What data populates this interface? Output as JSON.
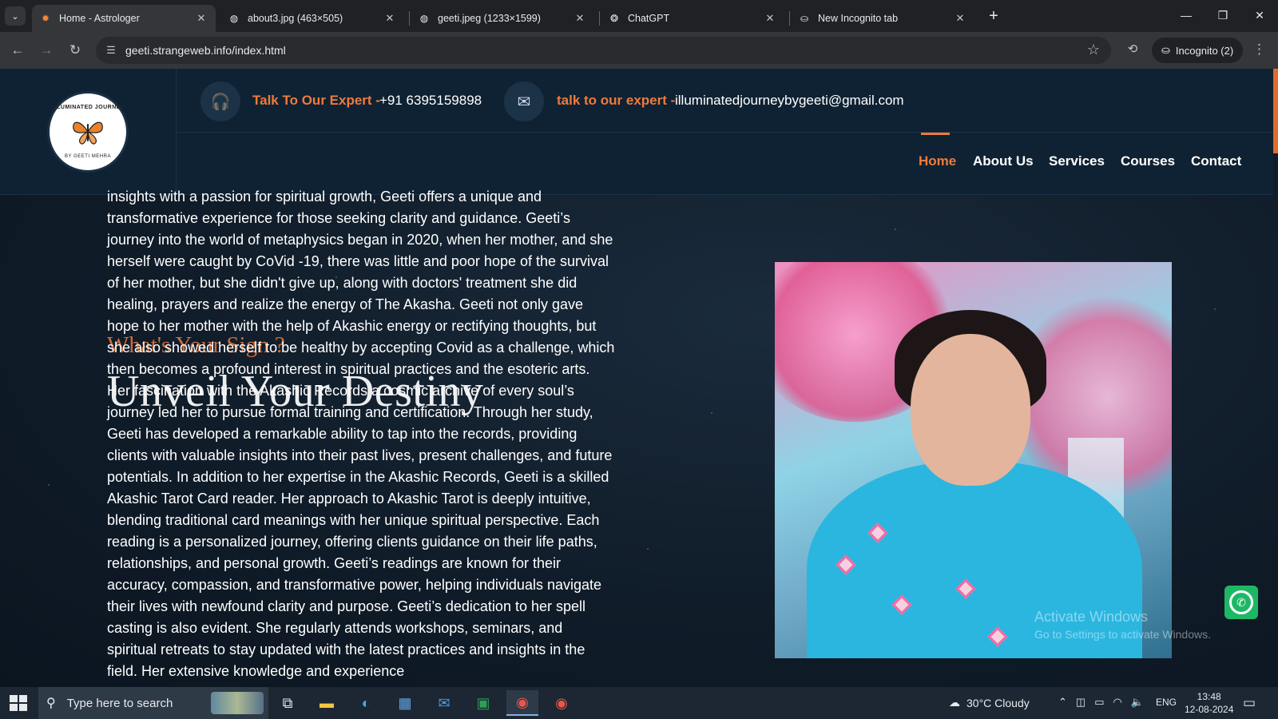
{
  "browser": {
    "tabs": [
      {
        "title": "Home - Astrologer",
        "icon": "sun-icon",
        "active": true
      },
      {
        "title": "about3.jpg (463×505)",
        "icon": "globe-icon",
        "active": false
      },
      {
        "title": "geeti.jpeg (1233×1599)",
        "icon": "globe-icon",
        "active": false
      },
      {
        "title": "ChatGPT",
        "icon": "chatgpt-icon",
        "active": false
      },
      {
        "title": "New Incognito tab",
        "icon": "incognito-icon",
        "active": false
      }
    ],
    "url": "geeti.strangeweb.info/index.html",
    "incognito_label": "Incognito (2)"
  },
  "site": {
    "logo": {
      "top_text": "ILLUMINATED JOURNEY",
      "bottom_text": "BY GEETI MEHRA"
    },
    "contact": {
      "phone_label": "Talk To Our Expert -",
      "phone_value": "+91 6395159898",
      "email_label": "talk to our expert -",
      "email_value": "illuminatedjourneybygeeti@gmail.com"
    },
    "nav": [
      {
        "label": "Home",
        "active": true
      },
      {
        "label": "About Us",
        "active": false
      },
      {
        "label": "Services",
        "active": false
      },
      {
        "label": "Courses",
        "active": false
      },
      {
        "label": "Contact",
        "active": false
      }
    ],
    "about_text": "insights with a passion for spiritual growth, Geeti offers a unique and transformative experience for those seeking clarity and guidance. Geeti’s journey into the world of metaphysics began in 2020, when her mother, and she herself were caught by CoVid -19, there was little and poor hope of the survival of her mother, but she didn't give up, along with doctors' treatment she did healing, prayers and realize the energy of The Akasha. Geeti not only gave hope to her mother with the help of Akashic energy or rectifying thoughts, but she also showed herself to be healthy by accepting Covid as a challenge, which then becomes a profound interest in spiritual practices and the esoteric arts. Her fascination with the Akashic Records a cosmic archive of every soul’s journey led her to pursue formal training and certification. Through her study, Geeti has developed a remarkable ability to tap into the records, providing clients with valuable insights into their past lives, present challenges, and future potentials. In addition to her expertise in the Akashic Records, Geeti is a skilled Akashic Tarot Card reader. Her approach to Akashic Tarot is deeply intuitive, blending traditional card meanings with her unique spiritual perspective. Each reading is a personalized journey, offering clients guidance on their life paths, relationships, and personal growth. Geeti’s readings are known for their accuracy, compassion, and transformative power, helping individuals navigate their lives with newfound clarity and purpose. Geeti’s dedication to her spell casting is also evident. She regularly attends workshops, seminars, and spiritual retreats to stay updated with the latest practices and insights in the field. Her extensive knowledge and experience",
    "sign_heading": "What's Your Sign ?",
    "destiny_heading": "Unveil Your Destiny",
    "watermark_title": "Activate Windows",
    "watermark_sub": "Go to Settings to activate Windows."
  },
  "taskbar": {
    "search_placeholder": "Type here to search",
    "weather": "30°C  Cloudy",
    "lang": "ENG",
    "time": "13:48",
    "date": "12-08-2024",
    "apps": [
      "task-view-icon",
      "file-explorer-icon",
      "edge-icon",
      "store-icon",
      "mail-icon",
      "excel-icon",
      "chrome-icon",
      "chrome-incognito-icon"
    ]
  },
  "colors": {
    "accent": "#ef7a3c",
    "header_bg": "#0f2233",
    "whatsapp": "#1eb865"
  }
}
